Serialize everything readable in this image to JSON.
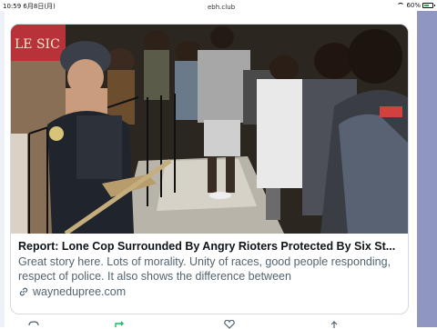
{
  "status_bar": {
    "time": "10:59",
    "date": "6月8日(月)",
    "url": "ebh.club",
    "battery_text": "60%",
    "battery_level": 0.6
  },
  "card": {
    "image_sign_text": "LE SIC",
    "headline": "Report: Lone Cop Surrounded By Angry Rioters Protected By Six St...",
    "summary": "Great story here. Lots of morality. Unity of races, good people responding, respect of police. It also shows the difference between",
    "domain": "waynedupree.com"
  },
  "colors": {
    "accent_edge": "#8f97c1",
    "text_primary": "#0f1419",
    "text_secondary": "#536471",
    "retweet_green": "#17bf63"
  },
  "icons": {
    "link": "link-icon",
    "reply": "reply-icon",
    "retweet": "retweet-icon",
    "like": "heart-icon",
    "share": "share-icon",
    "wifi": "wifi-icon",
    "battery": "battery-icon"
  }
}
